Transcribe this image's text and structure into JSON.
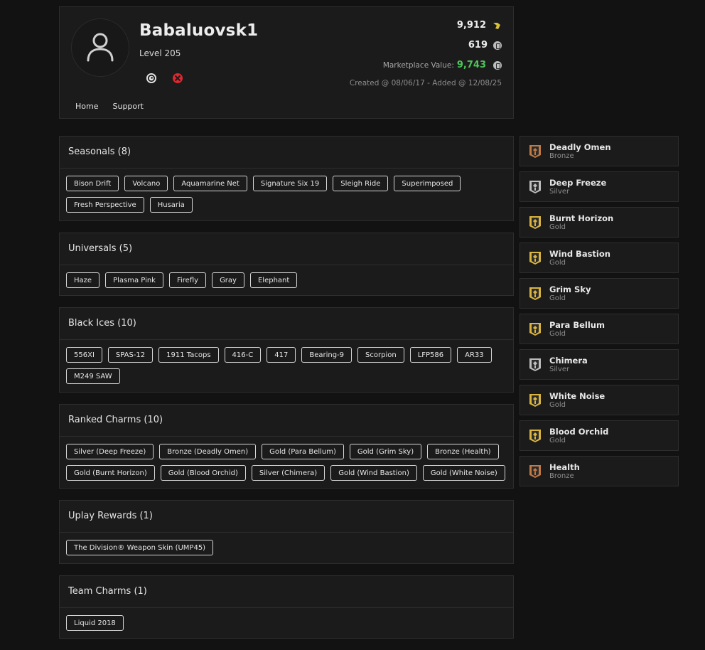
{
  "profile": {
    "username": "Babaluovsk1",
    "level": "Level 205",
    "renown": "9,912",
    "credits": "619",
    "marketplace_label": "Marketplace Value:",
    "marketplace_value": "9,743",
    "created": "Created @ 08/06/17 - Added @ 12/08/25",
    "nav": [
      "Home",
      "Support"
    ]
  },
  "sections": [
    {
      "title": "Seasonals (8)",
      "items": [
        "Bison Drift",
        "Volcano",
        "Aquamarine Net",
        "Signature Six 19",
        "Sleigh Ride",
        "Superimposed",
        "Fresh Perspective",
        "Husaria"
      ]
    },
    {
      "title": "Universals (5)",
      "items": [
        "Haze",
        "Plasma Pink",
        "Firefly",
        "Gray",
        "Elephant"
      ]
    },
    {
      "title": "Black Ices (10)",
      "items": [
        "556XI",
        "SPAS-12",
        "1911 Tacops",
        "416-C",
        "417",
        "Bearing-9",
        "Scorpion",
        "LFP586",
        "AR33",
        "M249 SAW"
      ]
    },
    {
      "title": "Ranked Charms (10)",
      "items": [
        "Silver (Deep Freeze)",
        "Bronze (Deadly Omen)",
        "Gold (Para Bellum)",
        "Gold (Grim Sky)",
        "Bronze (Health)",
        "Gold (Burnt Horizon)",
        "Gold (Blood Orchid)",
        "Silver (Chimera)",
        "Gold (Wind Bastion)",
        "Gold (White Noise)"
      ]
    },
    {
      "title": "Uplay Rewards (1)",
      "items": [
        "The Division® Weapon Skin (UMP45)"
      ]
    },
    {
      "title": "Team Charms (1)",
      "items": [
        "Liquid 2018"
      ]
    }
  ],
  "ranks": [
    {
      "name": "Deadly Omen",
      "tier": "Bronze"
    },
    {
      "name": "Deep Freeze",
      "tier": "Silver"
    },
    {
      "name": "Burnt Horizon",
      "tier": "Gold"
    },
    {
      "name": "Wind Bastion",
      "tier": "Gold"
    },
    {
      "name": "Grim Sky",
      "tier": "Gold"
    },
    {
      "name": "Para Bellum",
      "tier": "Gold"
    },
    {
      "name": "Chimera",
      "tier": "Silver"
    },
    {
      "name": "White Noise",
      "tier": "Gold"
    },
    {
      "name": "Blood Orchid",
      "tier": "Gold"
    },
    {
      "name": "Health",
      "tier": "Bronze"
    }
  ],
  "tier_colors": {
    "Gold": "#d9b43f",
    "Silver": "#bdbdbd",
    "Bronze": "#c07a44"
  },
  "icons": {
    "avatar": "user-icon",
    "platform_1": "uplay-icon",
    "platform_2": "xbox-icon",
    "renown": "renown-icon",
    "credits": "r6-credits-icon"
  }
}
